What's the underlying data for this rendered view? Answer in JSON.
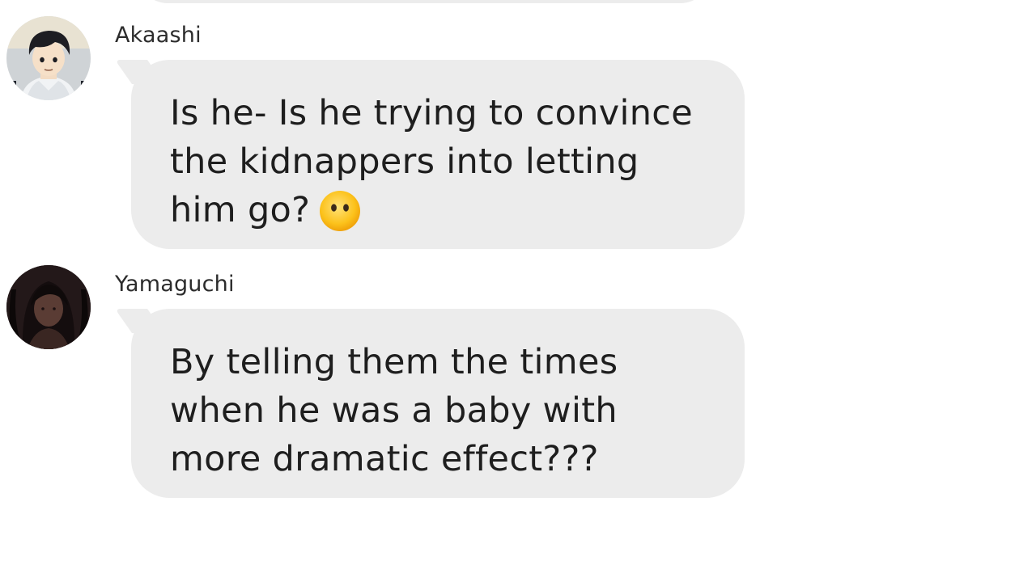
{
  "messages": [
    {
      "sender": "Akaashi",
      "lines": [
        "Is he- Is he trying to convince",
        "the kidnappers into letting",
        "him go?"
      ],
      "emoji": "neutral-face-emoji"
    },
    {
      "sender": "Yamaguchi",
      "lines": [
        "By telling them the times",
        "when he was a baby with",
        "more dramatic effect???"
      ]
    }
  ],
  "colors": {
    "bubble": "#ececec",
    "text": "#1e1e1e",
    "background": "#ffffff"
  }
}
